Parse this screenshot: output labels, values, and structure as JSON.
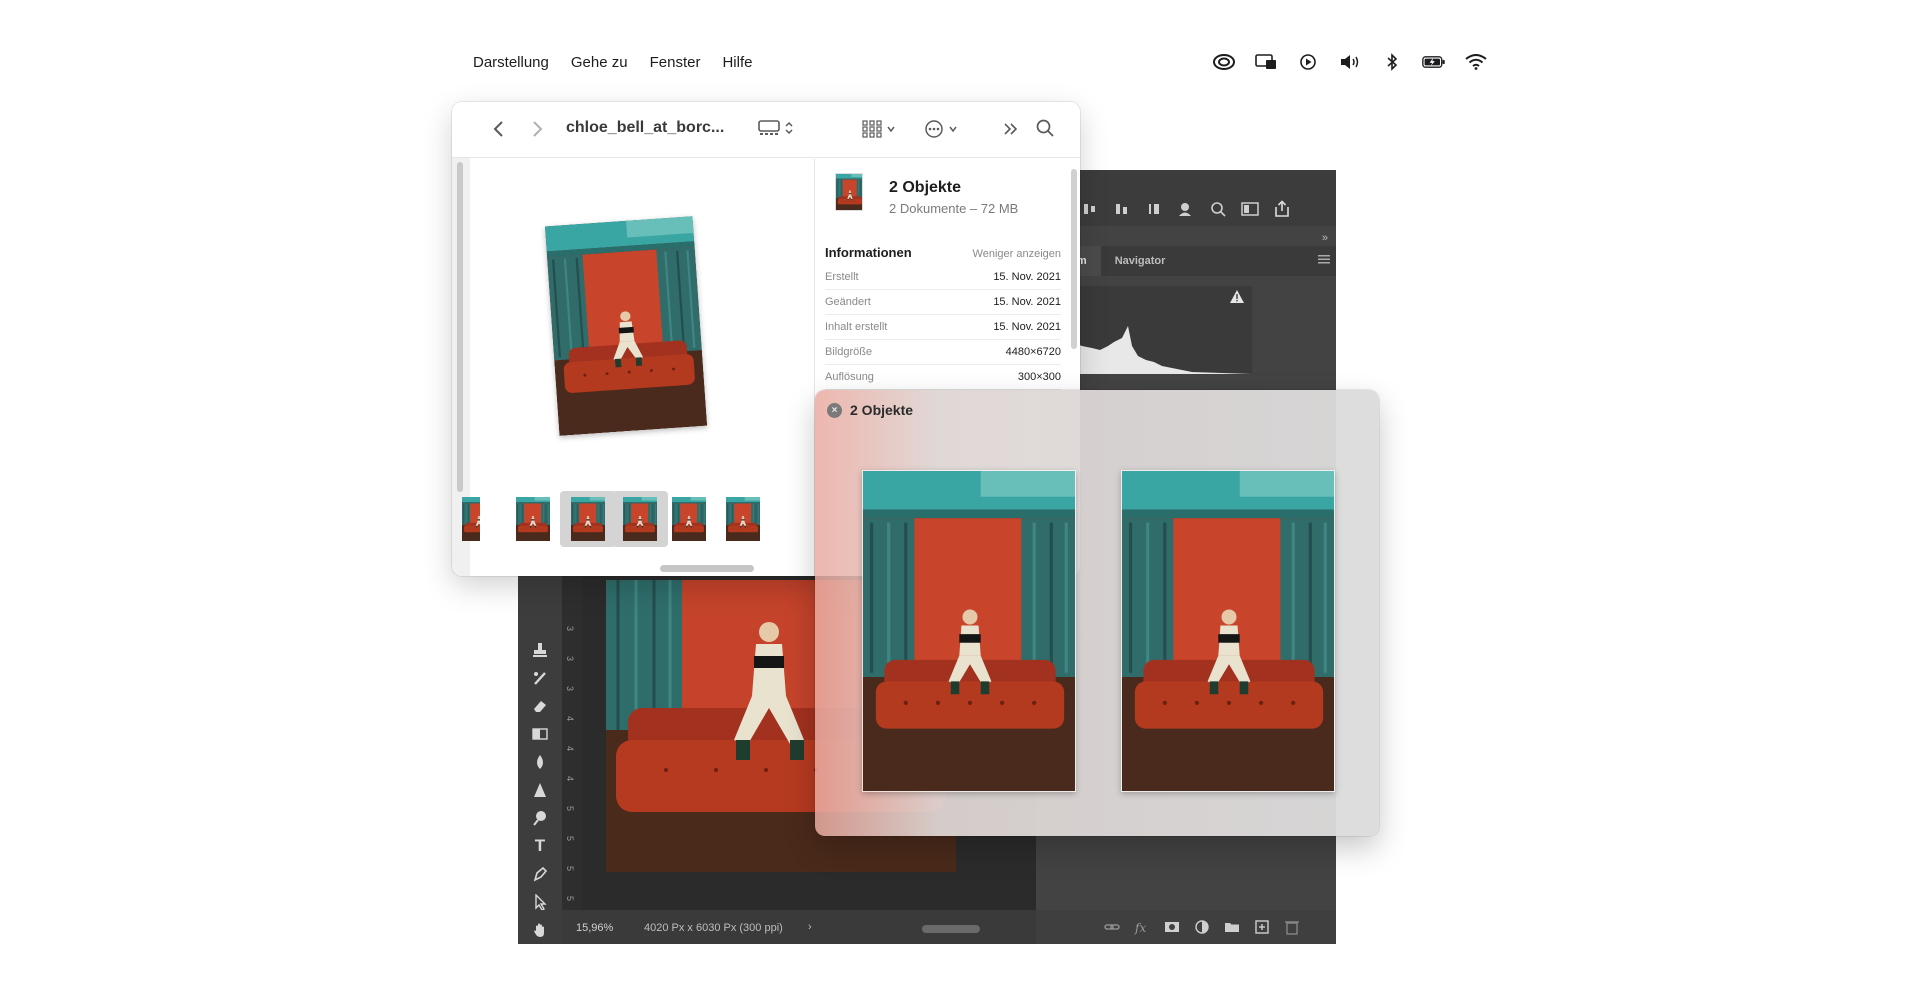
{
  "menubar": {
    "items": [
      "Darstellung",
      "Gehe zu",
      "Fenster",
      "Hilfe"
    ],
    "status_icons": [
      "creative-cloud-icon",
      "display-icon",
      "play-icon",
      "volume-icon",
      "bluetooth-icon",
      "battery-icon",
      "wifi-icon"
    ]
  },
  "finder": {
    "title": "chloe_bell_at_borc...",
    "info": {
      "title": "2 Objekte",
      "subtitle": "2 Dokumente – 72 MB",
      "heading": "Informationen",
      "show_less": "Weniger anzeigen",
      "rows": [
        {
          "label": "Erstellt",
          "value": "15. Nov. 2021"
        },
        {
          "label": "Geändert",
          "value": "15. Nov. 2021"
        },
        {
          "label": "Inhalt erstellt",
          "value": "15. Nov. 2021"
        },
        {
          "label": "Bildgröße",
          "value": "4480×6720"
        },
        {
          "label": "Auflösung",
          "value": "300×300"
        }
      ]
    }
  },
  "quicklook": {
    "title": "2 Objekte",
    "close_glyph": "×"
  },
  "photoshop": {
    "tabs": [
      "gramm",
      "Navigator"
    ],
    "zoom": "15,96%",
    "doc_info": "4020 Px x 6030 Px (300 ppi)",
    "doc_chevron": "›",
    "collapse_glyph": "»",
    "tools": {
      "type": "T",
      "more": "•••"
    },
    "ruler_labels": [
      "3",
      "3",
      "3",
      "4",
      "4",
      "4",
      "5",
      "5",
      "5",
      "5"
    ]
  },
  "colors": {
    "ps_bg": "#535353",
    "ps_dark": "#2b2b2b",
    "ql_tint": "#ebaaa0",
    "photo_teal": "#2d9c9a",
    "photo_wall": "#c7432b",
    "photo_sofa": "#a6301f"
  }
}
